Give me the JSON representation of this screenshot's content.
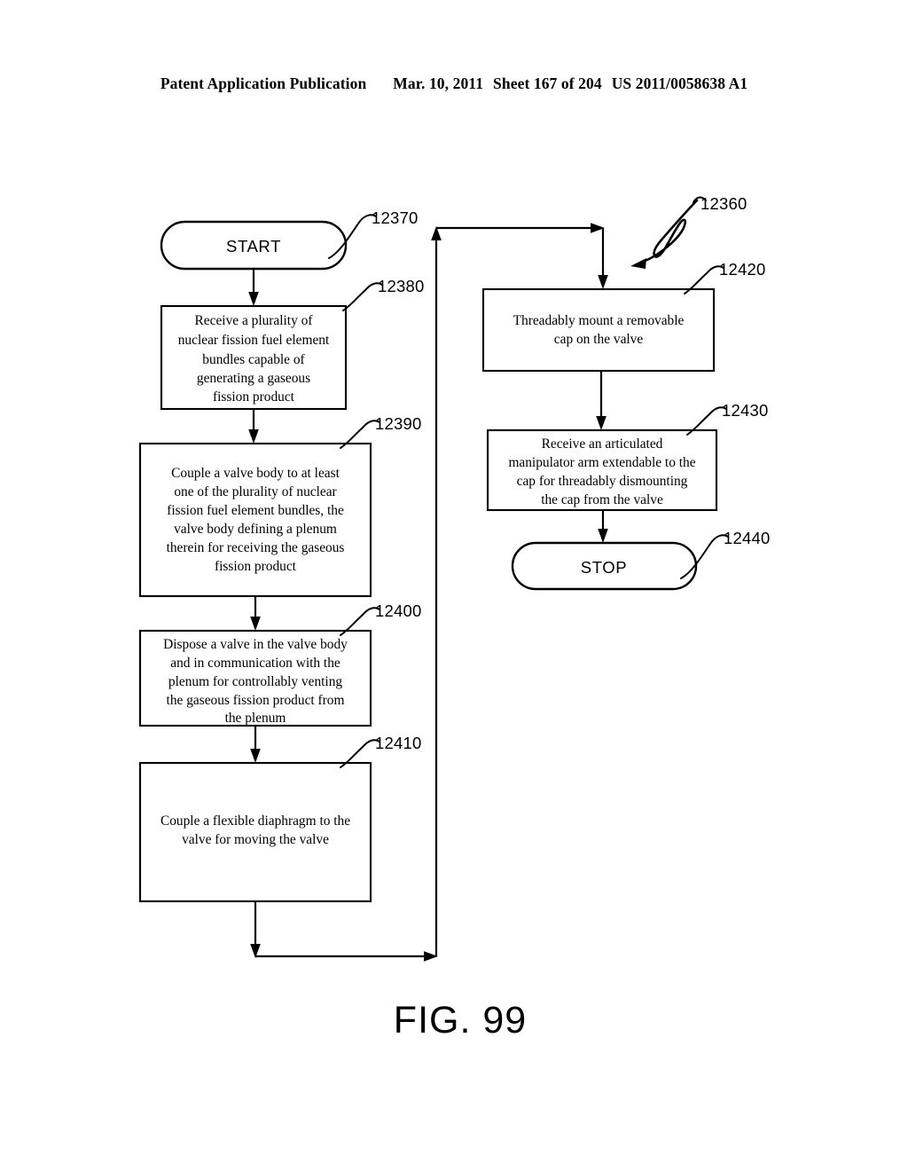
{
  "header": {
    "publication": "Patent Application Publication",
    "date": "Mar. 10, 2011",
    "sheet": "Sheet 167 of 204",
    "doc_number": "US 2011/0058638 A1"
  },
  "figure": {
    "caption": "FIG. 99",
    "diagram_ref": "12360"
  },
  "nodes": {
    "start": {
      "label": "START",
      "ref": "12370"
    },
    "step_12380": {
      "ref": "12380",
      "lines": [
        "Receive a plurality of",
        "nuclear fission fuel element",
        "bundles capable of",
        "generating a gaseous",
        "fission product"
      ]
    },
    "step_12390": {
      "ref": "12390",
      "lines": [
        "Couple a valve body to at least",
        "one of the plurality of nuclear",
        "fission fuel element bundles, the",
        "valve body defining a plenum",
        "therein for receiving the gaseous",
        "fission product"
      ]
    },
    "step_12400": {
      "ref": "12400",
      "lines": [
        "Dispose a valve in the valve body",
        "and in communication with the",
        "plenum for controllably venting",
        "the gaseous fission product from",
        "the plenum"
      ]
    },
    "step_12410": {
      "ref": "12410",
      "lines": [
        "Couple a flexible diaphragm to the",
        "valve for moving the valve"
      ]
    },
    "step_12420": {
      "ref": "12420",
      "lines": [
        "Threadably mount a removable",
        "cap on the valve"
      ]
    },
    "step_12430": {
      "ref": "12430",
      "lines": [
        "Receive an articulated",
        "manipulator arm extendable to the",
        "cap for threadably dismounting",
        "the cap from the valve"
      ]
    },
    "stop": {
      "label": "STOP",
      "ref": "12440"
    }
  },
  "colors": {
    "ink": "#000000",
    "paper": "#ffffff"
  }
}
